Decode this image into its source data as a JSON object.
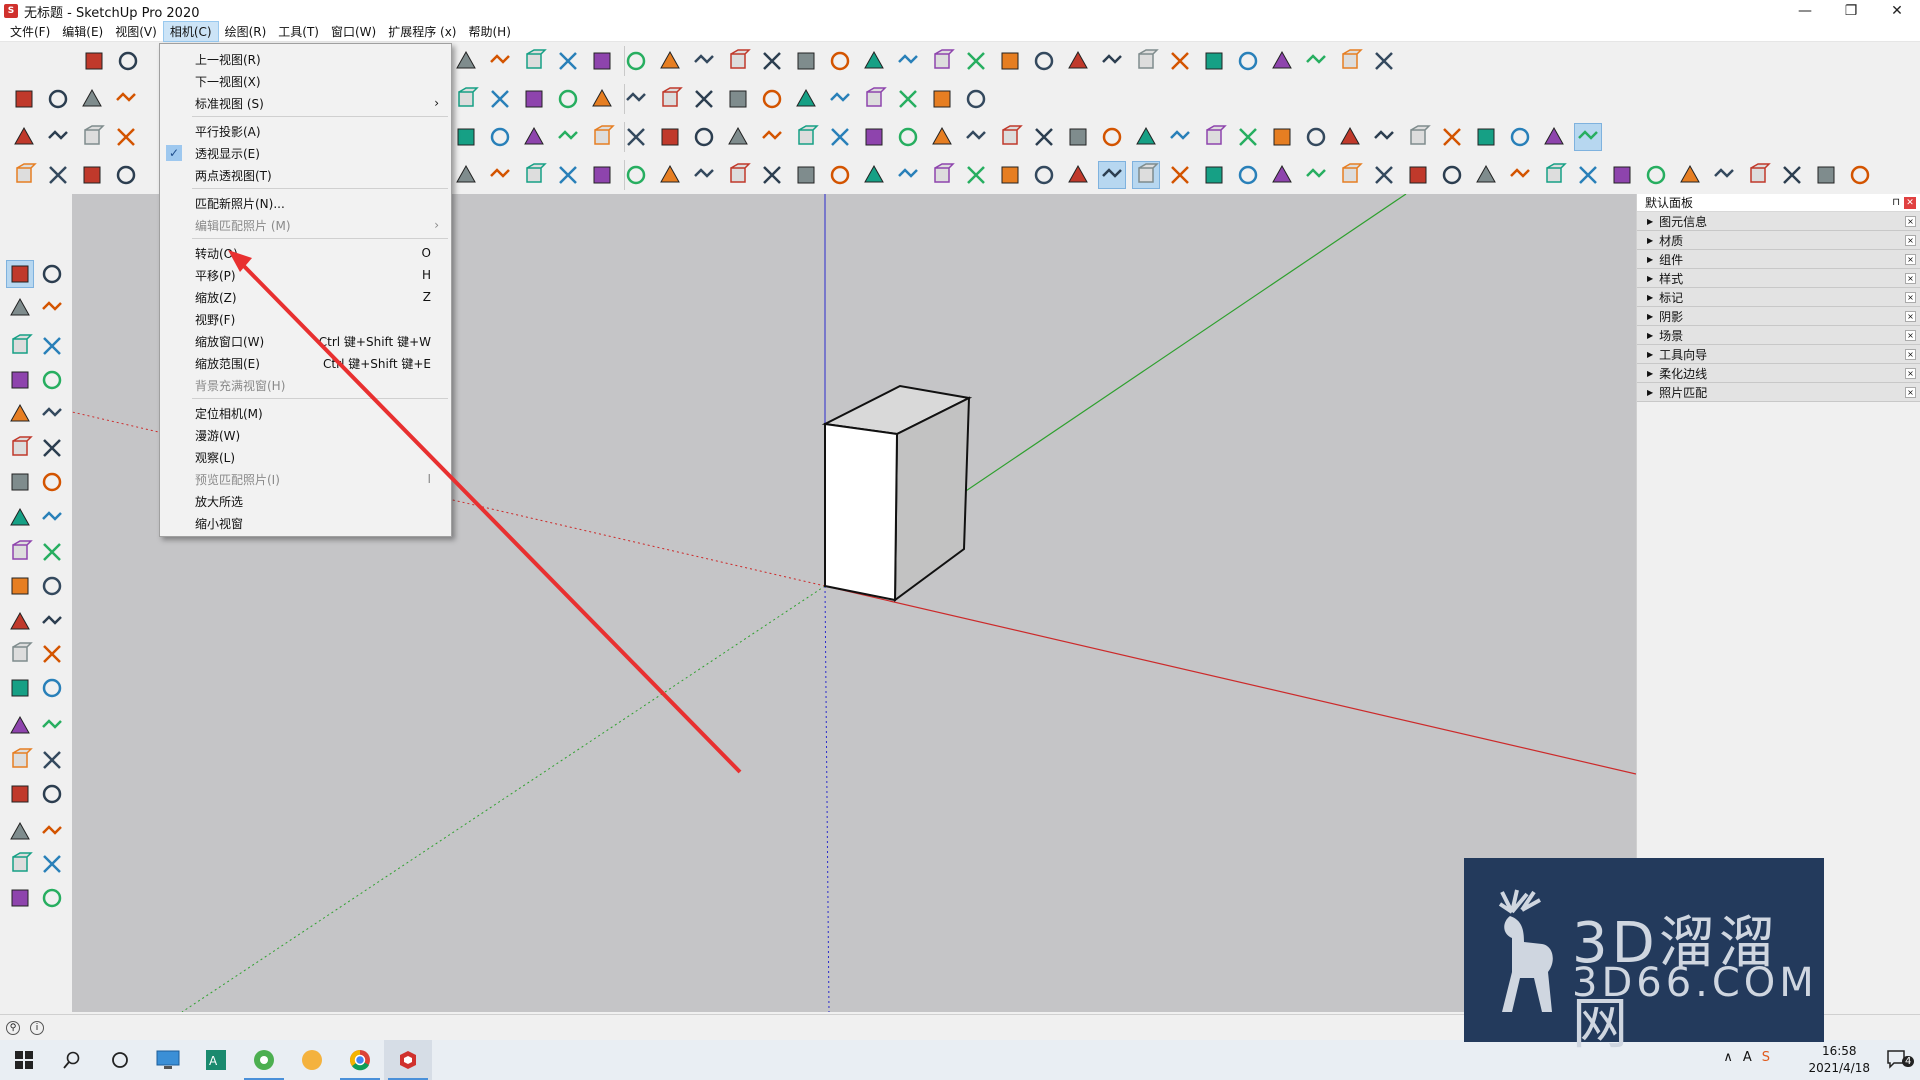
{
  "window": {
    "title": "无标题 - SketchUp Pro 2020",
    "controls": [
      "—",
      "❐",
      "✕"
    ]
  },
  "menubar": [
    {
      "label": "文件(F)"
    },
    {
      "label": "编辑(E)"
    },
    {
      "label": "视图(V)"
    },
    {
      "label": "相机(C)",
      "active": true
    },
    {
      "label": "绘图(R)"
    },
    {
      "label": "工具(T)"
    },
    {
      "label": "窗口(W)"
    },
    {
      "label": "扩展程序 (x)"
    },
    {
      "label": "帮助(H)"
    }
  ],
  "camera_menu": {
    "items": [
      {
        "label": "上一视图(R)"
      },
      {
        "label": "下一视图(X)"
      },
      {
        "label": "标准视图 (S)",
        "arrow": "›"
      },
      {
        "label": "平行投影(A)"
      },
      {
        "label": "透视显示(E)",
        "checked": true,
        "check_mark": "✓"
      },
      {
        "label": "两点透视图(T)"
      },
      {
        "label": "匹配新照片(N)..."
      },
      {
        "label": "编辑匹配照片 (M)",
        "disabled": true,
        "arrow": "›"
      },
      {
        "label": "转动(O)",
        "shortcut": "O"
      },
      {
        "label": "平移(P)",
        "shortcut": "H"
      },
      {
        "label": "缩放(Z)",
        "shortcut": "Z"
      },
      {
        "label": "视野(F)"
      },
      {
        "label": "缩放窗口(W)",
        "shortcut": "Ctrl 键+Shift 键+W"
      },
      {
        "label": "缩放范围(E)",
        "shortcut": "Ctrl 键+Shift 键+E"
      },
      {
        "label": "背景充满视窗(H)",
        "disabled": true
      },
      {
        "label": "定位相机(M)"
      },
      {
        "label": "漫游(W)"
      },
      {
        "label": "观察(L)"
      },
      {
        "label": "预览匹配照片(I)",
        "disabled": true,
        "shortcut": "I"
      },
      {
        "label": "放大所选"
      },
      {
        "label": "缩小视窗"
      }
    ]
  },
  "tray": {
    "title": "默认面板",
    "pin": "⊓",
    "close": "✕",
    "panels": [
      "图元信息",
      "材质",
      "组件",
      "样式",
      "标记",
      "阴影",
      "场景",
      "工具向导",
      "柔化边线",
      "照片匹配"
    ],
    "expander": "▶",
    "panel_close": "×"
  },
  "statusbar": {
    "icons": [
      "⚲",
      "i"
    ]
  },
  "taskbar": {
    "time": "16:58",
    "date": "2021/4/18",
    "notification_count": "4",
    "tray_glyphs": [
      "∧",
      "A",
      "S"
    ]
  },
  "watermark": {
    "cn": "3D溜溜网",
    "en": "3D66.COM"
  },
  "colors": {
    "viewport_bg": "#c5c5c7",
    "axis_red": "#cc2a2a",
    "axis_green": "#2ea02e",
    "axis_blue": "#2a2acc",
    "annotation": "#e83030",
    "menu_highlight": "#cce4f7"
  }
}
